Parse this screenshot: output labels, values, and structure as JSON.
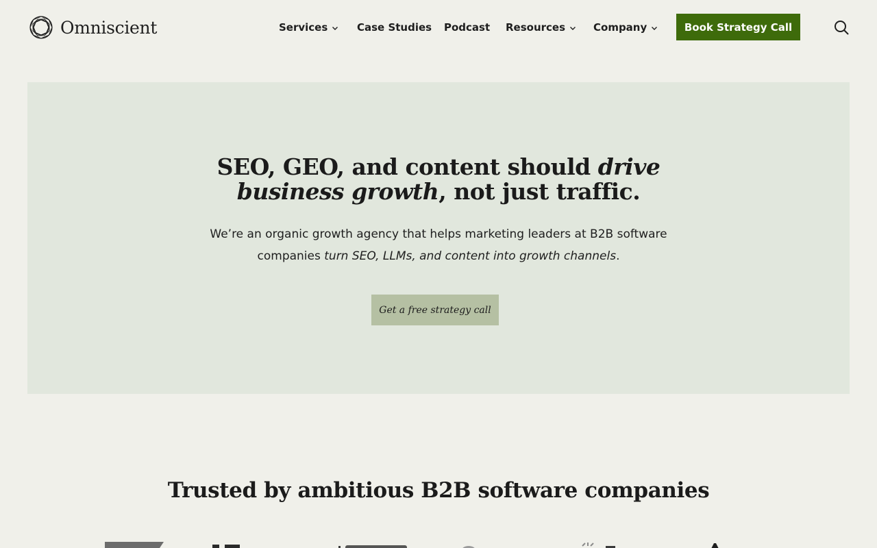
{
  "brand": {
    "name": "Omniscient",
    "logo_icon": "geometric-knot-icon"
  },
  "nav": {
    "items": [
      {
        "label": "Services",
        "has_dropdown": true
      },
      {
        "label": "Case Studies",
        "has_dropdown": false
      },
      {
        "label": "Podcast",
        "has_dropdown": false
      },
      {
        "label": "Resources",
        "has_dropdown": true
      },
      {
        "label": "Company",
        "has_dropdown": true
      }
    ],
    "cta_label": "Book Strategy Call",
    "search_icon": "search-icon"
  },
  "hero": {
    "title_part1": "SEO, GEO, and content should ",
    "title_em1": "drive",
    "title_em2": "business growth",
    "title_part2": ", not just traffic.",
    "subtitle_line1": "We’re an organic growth agency that helps marketing leaders at B2B software",
    "subtitle_part2": "companies ",
    "subtitle_em": "turn SEO, LLMs, and content into growth channels",
    "subtitle_end": ".",
    "button_label": "Get a free strategy call"
  },
  "trusted": {
    "heading": "Trusted by ambitious B2B software companies"
  },
  "colors": {
    "page_bg": "#f0f0ea",
    "hero_bg": "#e1e7dd",
    "cta_bg": "#3e6b0b",
    "hero_button_bg": "#b5c0a3",
    "text": "#1b1b1b"
  }
}
